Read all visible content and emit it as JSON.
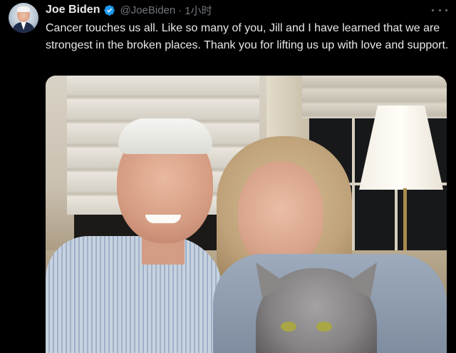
{
  "post": {
    "author_name": "Joe Biden",
    "handle": "@JoeBiden",
    "separator": "·",
    "time": "1小时",
    "text": "Cancer touches us all. Like so many of you, Jill and I have learned that we are strongest in the broken places. Thank you for lifting us up with love and support."
  },
  "icons": {
    "verified": "verified-badge-icon",
    "more": "more-options-icon"
  },
  "colors": {
    "background": "#000000",
    "text": "#e7e9ea",
    "secondary_text": "#71767b",
    "verified": "#1d9bf0"
  }
}
